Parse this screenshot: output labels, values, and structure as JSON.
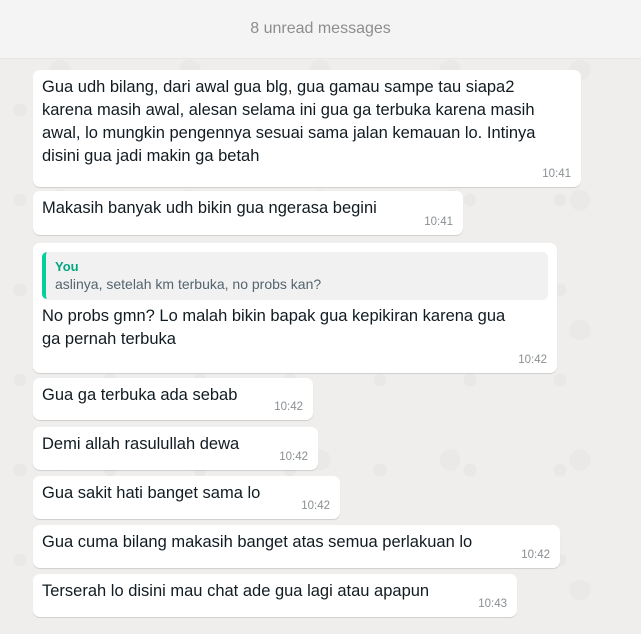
{
  "banner": {
    "unread_label": "8 unread messages"
  },
  "messages": [
    {
      "text": "Gua udh bilang, dari awal gua blg, gua gamau sampe tau siapa2\nkarena masih awal, alesan selama ini gua ga terbuka karena masih\nawal, lo mungkin pengennya sesuai sama jalan kemauan lo. Intinya\ndisini gua jadi makin ga betah",
      "time": "10:41"
    },
    {
      "text": "Makasih banyak udh bikin gua ngerasa begini",
      "time": "10:41"
    },
    {
      "quote_author": "You",
      "quote_text": "aslinya, setelah km terbuka, no probs kan?",
      "text": "No probs gmn? Lo malah bikin bapak gua kepikiran karena gua\nga pernah terbuka",
      "time": "10:42"
    },
    {
      "text": "Gua ga terbuka ada sebab",
      "time": "10:42"
    },
    {
      "text": "Demi allah rasulullah dewa",
      "time": "10:42"
    },
    {
      "text": "Gua sakit hati banget sama lo",
      "time": "10:42"
    },
    {
      "text": "Gua cuma bilang makasih banget atas semua perlakuan lo",
      "time": "10:42"
    },
    {
      "text": "Terserah lo disini mau chat ade gua lagi atau apapun",
      "time": "10:43"
    }
  ]
}
